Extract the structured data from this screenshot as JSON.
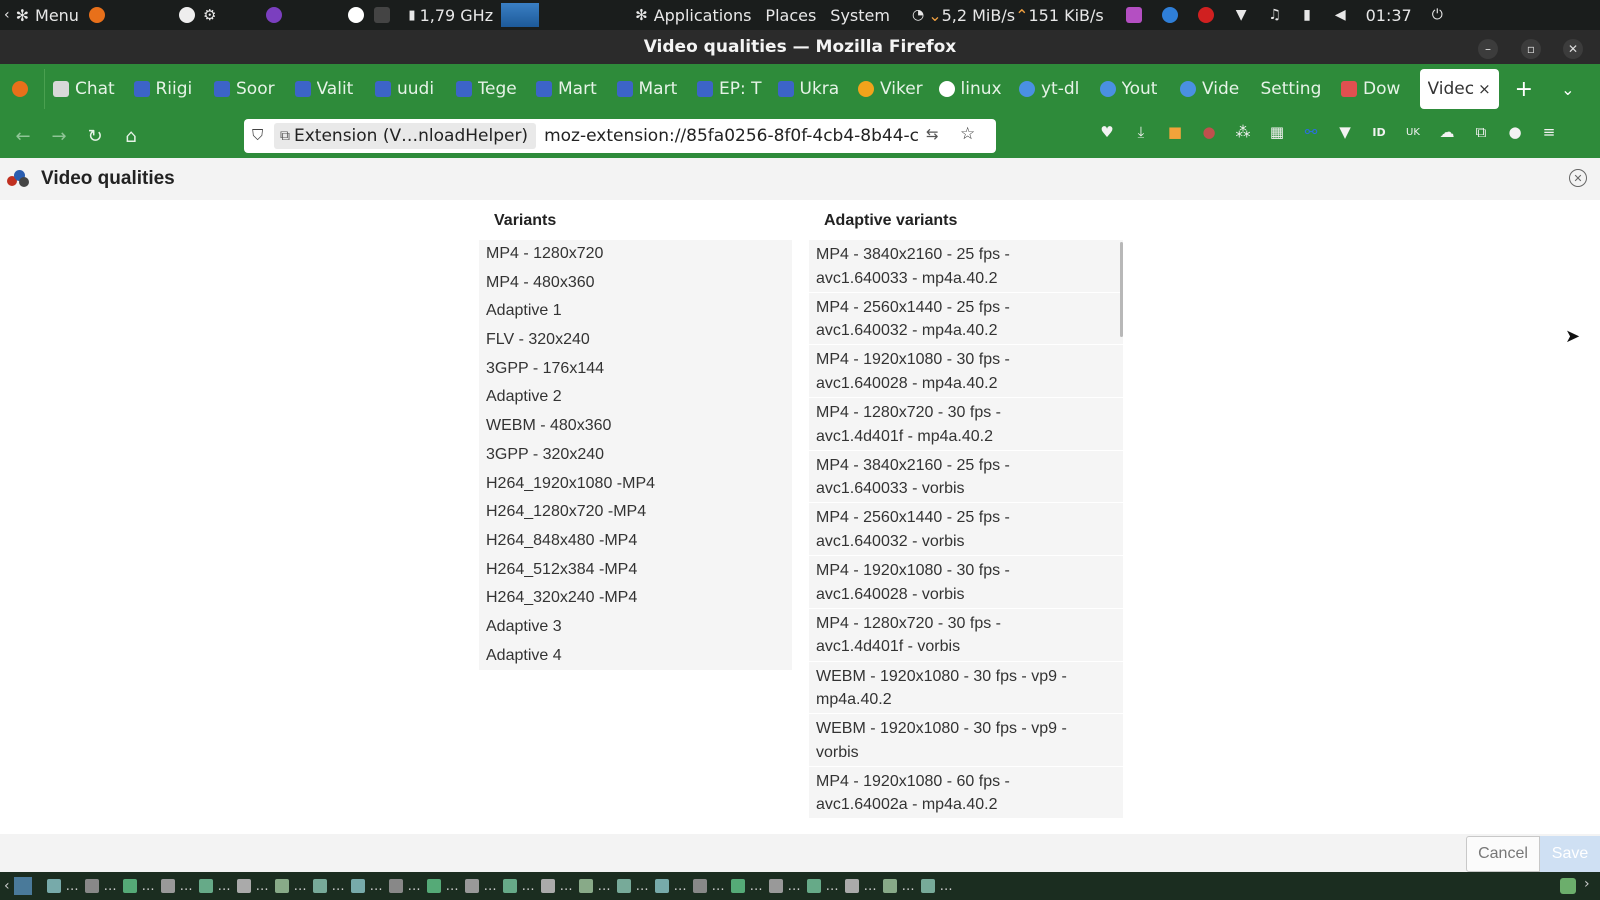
{
  "system_panel": {
    "menu_label": "Menu",
    "cpu_freq": "1,79 GHz",
    "applications": "Applications",
    "places": "Places",
    "system": "System",
    "net_down": "5,2 MiB/s",
    "net_up": "151 KiB/s",
    "clock": "01:37",
    "colors": {
      "background": "#1a1d1c"
    }
  },
  "window": {
    "title": "Video qualities — Mozilla Firefox"
  },
  "tabs": [
    {
      "label": "Chat",
      "icon": "chatgpt-icon"
    },
    {
      "label": "Riigi",
      "icon": "site-icon"
    },
    {
      "label": "Soor",
      "icon": "site-icon"
    },
    {
      "label": "Valit",
      "icon": "site-icon"
    },
    {
      "label": "uudi",
      "icon": "site-icon"
    },
    {
      "label": "Tege",
      "icon": "site-icon"
    },
    {
      "label": "Mart",
      "icon": "site-icon"
    },
    {
      "label": "Mart",
      "icon": "site-icon"
    },
    {
      "label": "EP: T",
      "icon": "site-icon"
    },
    {
      "label": "Ukra",
      "icon": "site-icon"
    },
    {
      "label": "Viker",
      "icon": "viker-icon"
    },
    {
      "label": "linux",
      "icon": "google-icon"
    },
    {
      "label": "yt-dl",
      "icon": "globe-icon"
    },
    {
      "label": "Yout",
      "icon": "globe-icon"
    },
    {
      "label": "Vide",
      "icon": "globe-icon"
    },
    {
      "label": "Setting",
      "icon": ""
    },
    {
      "label": "Dow",
      "icon": "extension-icon"
    }
  ],
  "active_tab": {
    "label": "Videc",
    "close": "×"
  },
  "new_tab": "+",
  "urlbar": {
    "identity": "Extension (V…nloadHelper)",
    "url": "moz-extension://85fa0256-8f0f-4cb4-8b44-c"
  },
  "dialog": {
    "title": "Video qualities",
    "variants_header": "Variants",
    "adaptive_header": "Adaptive variants",
    "variants": [
      "MP4 - 1280x720",
      "MP4 - 480x360",
      "Adaptive 1",
      "FLV - 320x240",
      "3GPP - 176x144",
      "Adaptive 2",
      "WEBM - 480x360",
      "3GPP - 320x240",
      "H264_1920x1080 -MP4",
      "H264_1280x720 -MP4",
      "H264_848x480 -MP4",
      "H264_512x384 -MP4",
      "H264_320x240 -MP4",
      "Adaptive 3",
      "Adaptive 4"
    ],
    "adaptive_variants": [
      {
        "line1": "MP4 - 3840x2160 - 25 fps -",
        "line2": "avc1.640033 - mp4a.40.2"
      },
      {
        "line1": "MP4 - 2560x1440 - 25 fps -",
        "line2": "avc1.640032 - mp4a.40.2"
      },
      {
        "line1": "MP4 - 1920x1080 - 30 fps -",
        "line2": "avc1.640028 - mp4a.40.2"
      },
      {
        "line1": "MP4 - 1280x720 - 30 fps -",
        "line2": "avc1.4d401f - mp4a.40.2"
      },
      {
        "line1": "MP4 - 3840x2160 - 25 fps -",
        "line2": "avc1.640033 - vorbis"
      },
      {
        "line1": "MP4 - 2560x1440 - 25 fps -",
        "line2": "avc1.640032 - vorbis"
      },
      {
        "line1": "MP4 - 1920x1080 - 30 fps -",
        "line2": "avc1.640028 - vorbis"
      },
      {
        "line1": "MP4 - 1280x720 - 30 fps -",
        "line2": "avc1.4d401f - vorbis"
      },
      {
        "line1": "WEBM - 1920x1080 - 30 fps - vp9 -",
        "line2": "mp4a.40.2"
      },
      {
        "line1": "WEBM - 1920x1080 - 30 fps - vp9 -",
        "line2": "vorbis"
      },
      {
        "line1": "MP4 - 1920x1080 - 60 fps -",
        "line2": "avc1.64002a - mp4a.40.2"
      }
    ],
    "cancel_label": "Cancel",
    "save_label": "Save"
  },
  "taskbar": {
    "ellipsis": "…",
    "item_count": 24
  },
  "colors": {
    "toolbar_green": "#2e8b3a",
    "titlebar": "#2b2b2b",
    "row_bg": "#f5f5f5",
    "save_button": "#cfe0f3"
  }
}
